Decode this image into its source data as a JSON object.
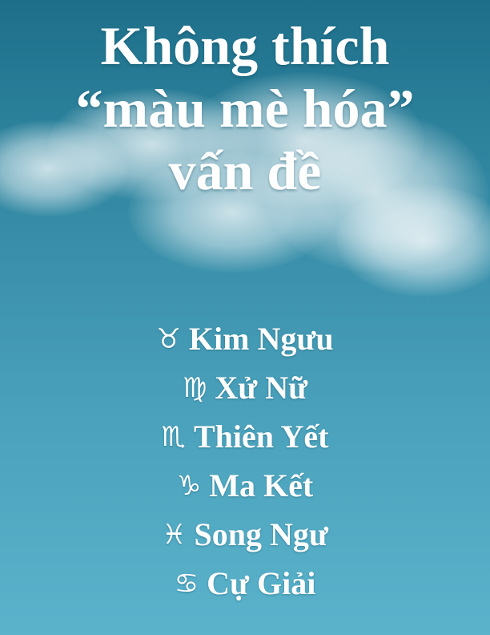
{
  "title": {
    "line1": "Không thích",
    "line2": "“màu mè hóa”",
    "line3": "vấn đề"
  },
  "signs": [
    {
      "symbol": "♉",
      "name": "Kim Ngưu"
    },
    {
      "symbol": "♍",
      "name": "Xử Nữ"
    },
    {
      "symbol": "♏",
      "name": "Thiên Yết"
    },
    {
      "symbol": "♑",
      "name": "Ma Kết"
    },
    {
      "symbol": "♓",
      "name": "Song Ngư"
    },
    {
      "symbol": "♋",
      "name": "Cự Giải"
    }
  ],
  "colors": {
    "sky_top": "#1e6f8a",
    "sky_bottom": "#5ab2cb",
    "text": "#ffffff"
  }
}
